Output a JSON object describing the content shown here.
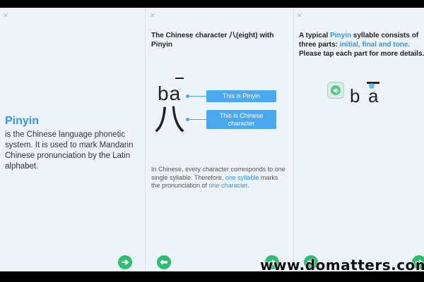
{
  "panels": {
    "one": {
      "close_icon": "×",
      "title": "Pinyin",
      "description": "is the Chinese language phonetic system. It is used to mark Mandarin Chinese pronunciation by the Latin alphabet.",
      "next_icon": "➔"
    },
    "two": {
      "close_icon": "×",
      "heading": "The Chinese character 八(eight) with Pinyin",
      "syllable": "ba",
      "character": "八",
      "callout_pinyin": "This is Pinyin",
      "callout_character": "This is Chinese character",
      "body_part1": "In Chinese, every character corresponds to one single syllable. Therefore, ",
      "body_link1": "one syllable",
      "body_part2": " marks the pronunciation of ",
      "body_link2": "one character",
      "body_end": ".",
      "back_icon": "⬅",
      "next_icon": "➔"
    },
    "three": {
      "close_icon": "×",
      "heading_part1": "A typical ",
      "heading_link1": "Pinyin",
      "heading_part2": " syllable consists of three parts: ",
      "heading_link2": "initial, final and tone.",
      "heading_part3": " Please tap each part for more details.",
      "speaker_icon": "🔊",
      "initial": "b",
      "final": "a",
      "back_icon": "⬅",
      "next_icon": "➔"
    }
  },
  "watermark": "www.domatters.com",
  "colors": {
    "accent_blue": "#2f97e6",
    "callout_blue": "#4aa8ee",
    "nav_green": "#2bbf6e",
    "background": "#eef3f9"
  }
}
